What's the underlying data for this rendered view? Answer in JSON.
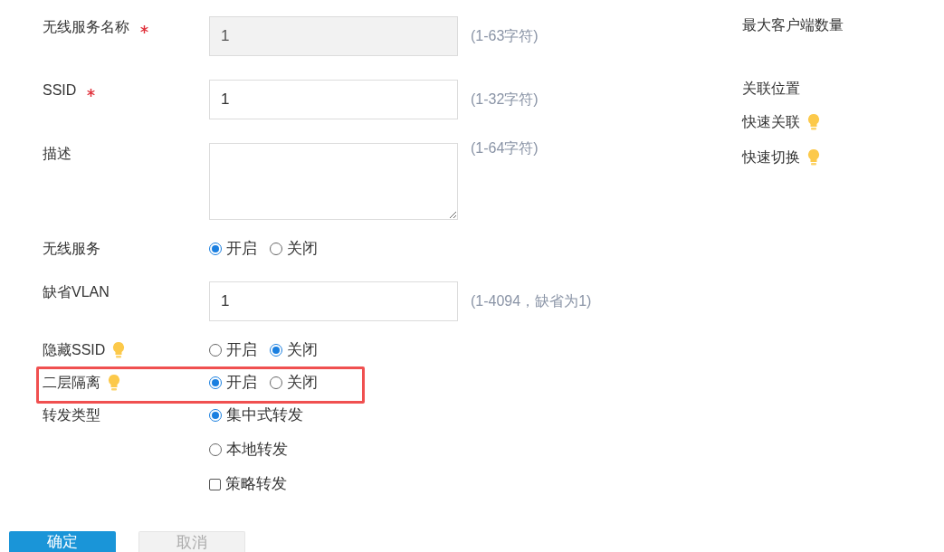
{
  "fields": [
    {
      "kind": "text",
      "label": "无线服务名称",
      "required": true,
      "tip": false,
      "value": "1",
      "hint": "(1-63字符)",
      "disabled": true
    },
    {
      "kind": "text",
      "label": "SSID",
      "required": true,
      "tip": false,
      "value": "1",
      "hint": "(1-32字符)",
      "disabled": false
    },
    {
      "kind": "textarea",
      "label": "描述",
      "required": false,
      "tip": false,
      "hint": "(1-64字符)"
    },
    {
      "kind": "choice",
      "label": "无线服务",
      "tip": false,
      "highlighted": false,
      "stacked": false,
      "options": [
        {
          "kind": "radio",
          "label": "开启",
          "selected": true
        },
        {
          "kind": "radio",
          "label": "关闭",
          "selected": false
        }
      ]
    },
    {
      "kind": "text",
      "label": "缺省VLAN",
      "required": false,
      "tip": false,
      "value": "1",
      "hint": "(1-4094，缺省为1)",
      "disabled": false
    },
    {
      "kind": "choice",
      "label": "隐藏SSID",
      "tip": true,
      "highlighted": false,
      "stacked": false,
      "options": [
        {
          "kind": "radio",
          "label": "开启",
          "selected": false
        },
        {
          "kind": "radio",
          "label": "关闭",
          "selected": true
        }
      ]
    },
    {
      "kind": "choice",
      "label": "二层隔离",
      "tip": true,
      "highlighted": true,
      "stacked": false,
      "options": [
        {
          "kind": "radio",
          "label": "开启",
          "selected": true
        },
        {
          "kind": "radio",
          "label": "关闭",
          "selected": false
        }
      ]
    },
    {
      "kind": "choice",
      "label": "转发类型",
      "tip": false,
      "highlighted": false,
      "stacked": true,
      "options": [
        {
          "kind": "radio",
          "label": "集中式转发",
          "selected": true
        },
        {
          "kind": "radio",
          "label": "本地转发",
          "selected": false
        },
        {
          "kind": "checkbox",
          "label": "策略转发",
          "selected": false
        }
      ]
    }
  ],
  "side_items": [
    {
      "label": "最大客户端数量",
      "tip": false
    },
    {
      "label": "关联位置",
      "tip": false
    },
    {
      "label": "快速关联",
      "tip": true
    },
    {
      "label": "快速切换",
      "tip": true
    }
  ],
  "buttons": [
    {
      "label": "确定",
      "kind": "primary"
    },
    {
      "label": "取消",
      "kind": "secondary"
    }
  ]
}
